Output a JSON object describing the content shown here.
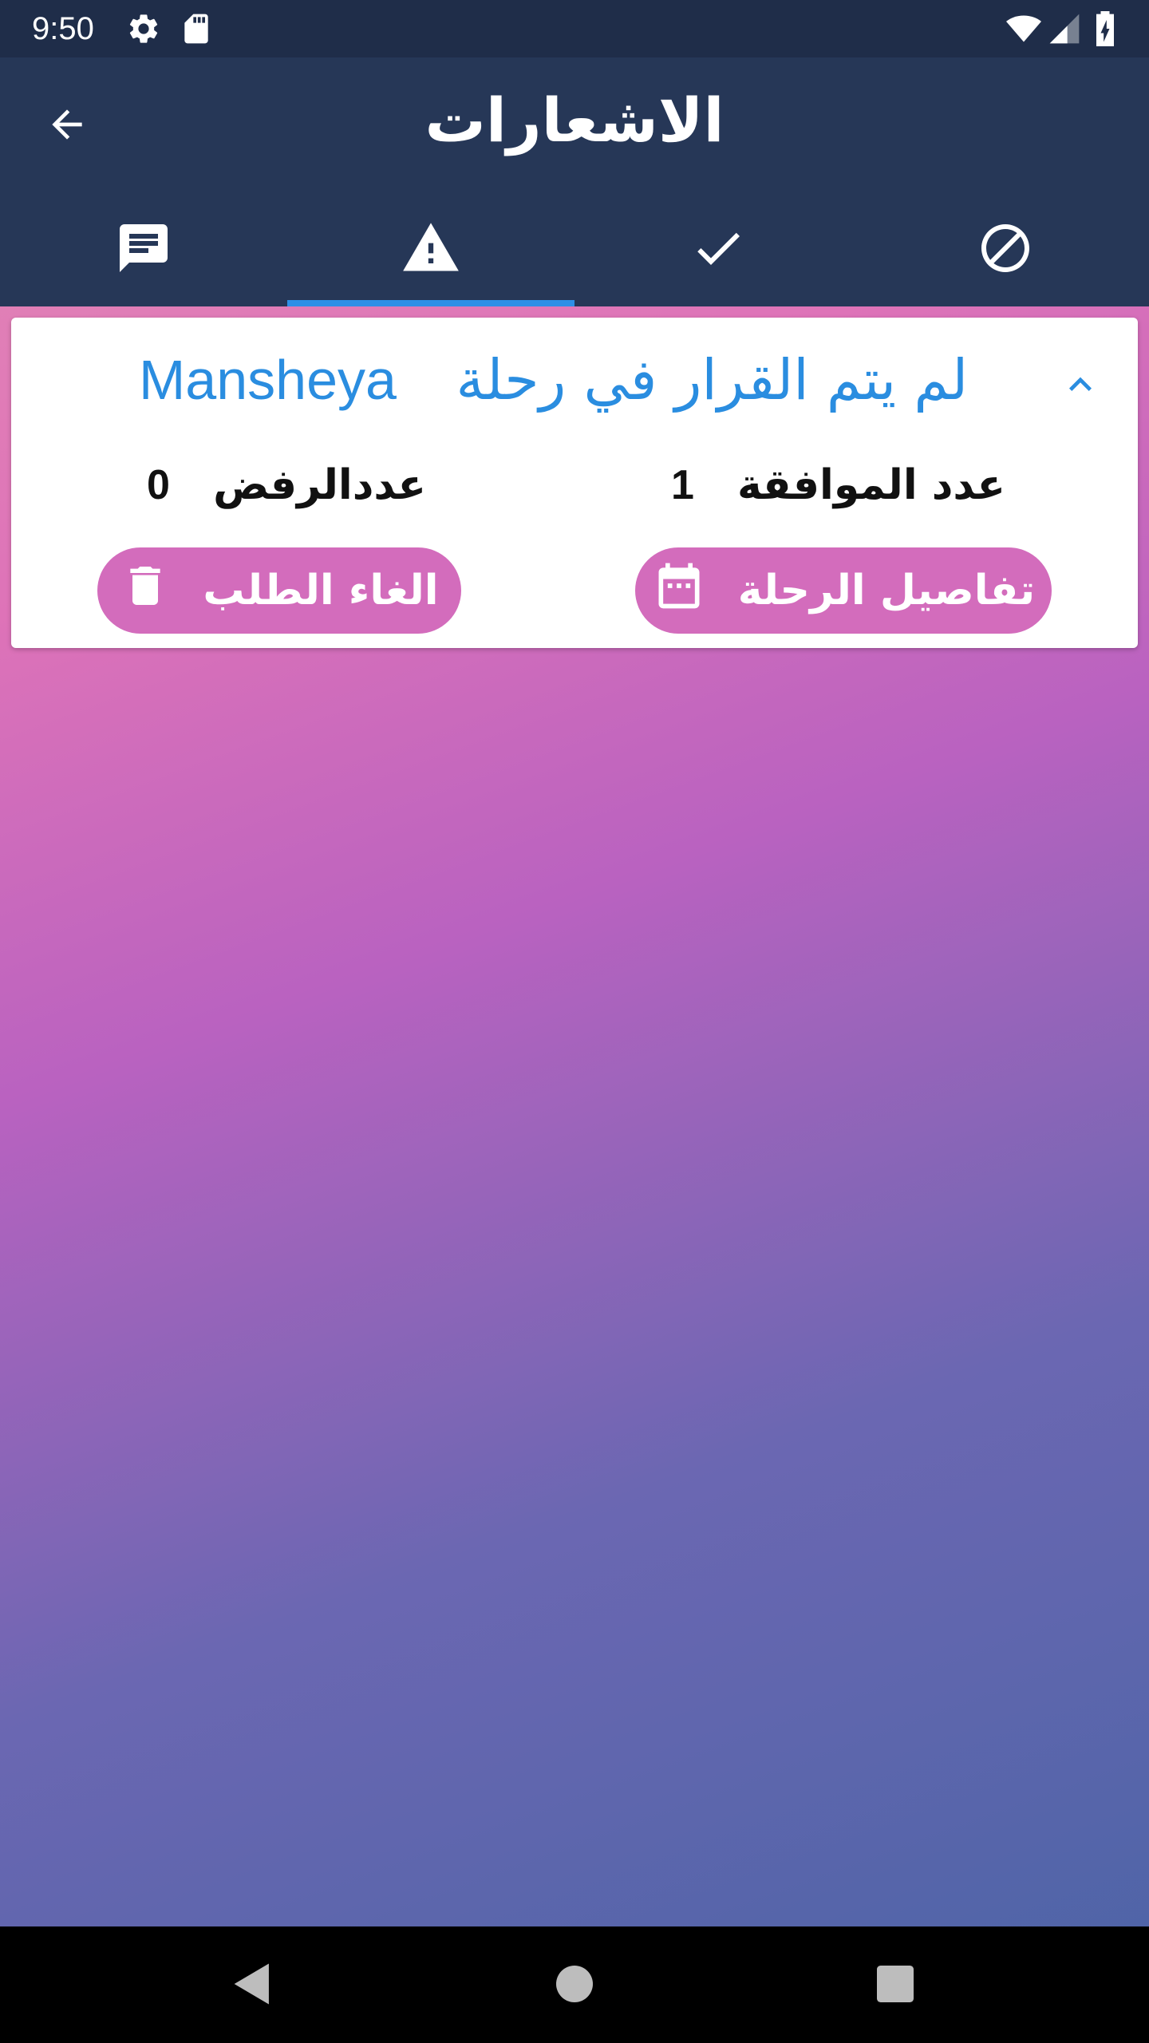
{
  "status_bar": {
    "time": "9:50",
    "icons": [
      "settings-icon",
      "sd-card-icon",
      "wifi-icon",
      "cellular-signal-icon",
      "battery-charging-icon"
    ]
  },
  "app_bar": {
    "title": "الاشعارات",
    "back_icon": "arrow-back-icon",
    "tabs": [
      {
        "icon": "message-icon",
        "selected": false
      },
      {
        "icon": "warning-icon",
        "selected": true
      },
      {
        "icon": "check-icon",
        "selected": false
      },
      {
        "icon": "block-icon",
        "selected": false
      }
    ],
    "indicator_color": "#2e8fe6"
  },
  "card": {
    "title_prefix": "لم يتم القرار في رحلة",
    "place": "Mansheya",
    "approve_label": "عدد الموافقة",
    "approve_count": "1",
    "reject_label": "عددالرفض",
    "reject_count": "0",
    "details_button": "تفاصيل الرحلة",
    "cancel_button": "الغاء الطلب",
    "accent_color": "#2a8de0",
    "button_color": "#d36cbc"
  },
  "nav_bar": {
    "icons": [
      "nav-back-icon",
      "nav-home-icon",
      "nav-recents-icon"
    ]
  }
}
